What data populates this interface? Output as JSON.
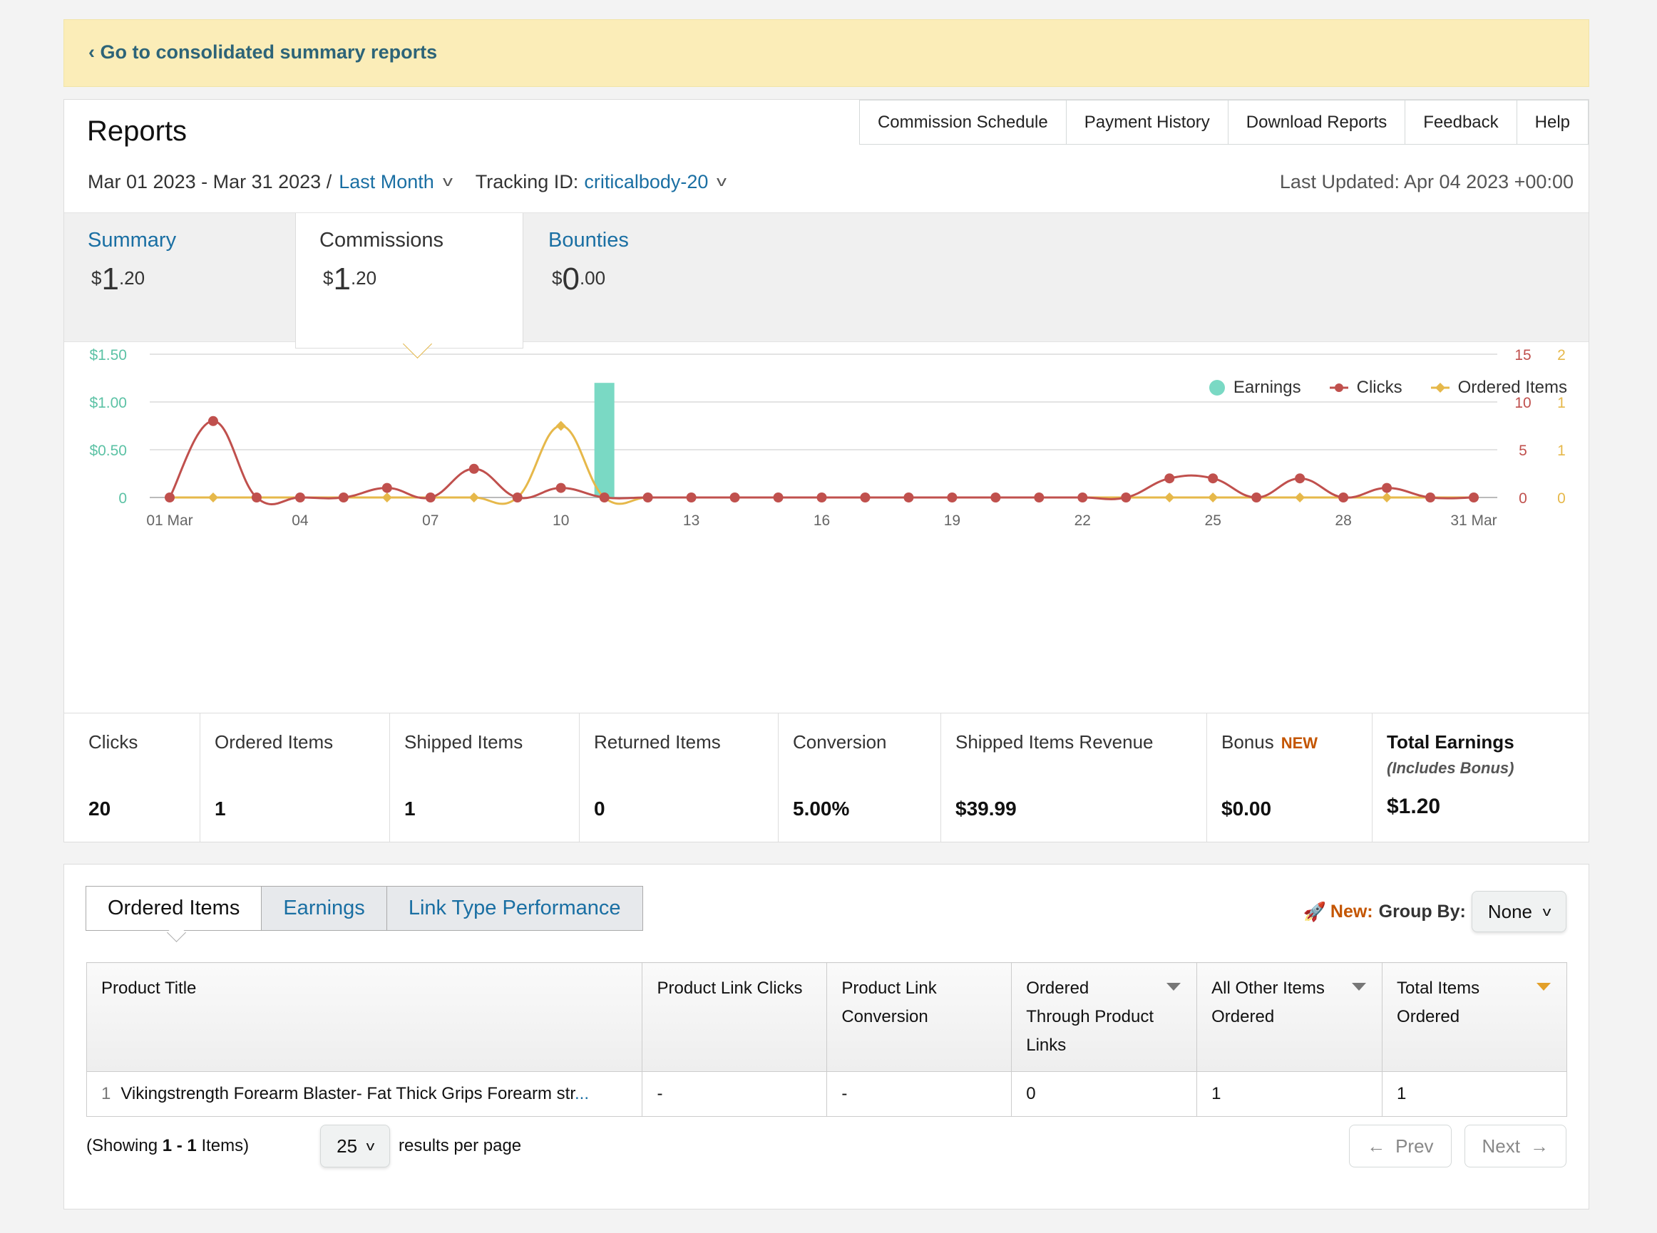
{
  "banner": {
    "link": "‹ Go to consolidated summary reports"
  },
  "header": {
    "title": "Reports",
    "nav": [
      "Commission Schedule",
      "Payment History",
      "Download Reports",
      "Feedback",
      "Help"
    ],
    "date_range": "Mar 01 2023 - Mar 31 2023 /",
    "period": "Last Month",
    "tracking_label": "Tracking ID:",
    "tracking_id": "criticalbody-20",
    "last_updated": "Last Updated: Apr 04 2023 +00:00"
  },
  "summary_tabs": [
    {
      "label": "Summary",
      "currency": "$",
      "dollars": "1",
      "cents": ".20"
    },
    {
      "label": "Commissions",
      "currency": "$",
      "dollars": "1",
      "cents": ".20"
    },
    {
      "label": "Bounties",
      "currency": "$",
      "dollars": "0",
      "cents": ".00"
    }
  ],
  "colors": {
    "earnings": "#7ad9c4",
    "clicks": "#c0504d",
    "ordered": "#e6b84a",
    "link": "#1a6fa3",
    "accent": "#c45500"
  },
  "chart_data": {
    "type": "line",
    "legend": [
      "Earnings",
      "Clicks",
      "Ordered Items"
    ],
    "x": [
      "01 Mar",
      "02",
      "03",
      "04",
      "05",
      "06",
      "07",
      "08",
      "09",
      "10",
      "11",
      "12",
      "13",
      "14",
      "15",
      "16",
      "17",
      "18",
      "19",
      "20",
      "21",
      "22",
      "23",
      "24",
      "25",
      "26",
      "27",
      "28",
      "29",
      "30",
      "31 Mar"
    ],
    "x_tick_labels": [
      "01 Mar",
      "04",
      "07",
      "10",
      "13",
      "16",
      "19",
      "22",
      "25",
      "28",
      "31 Mar"
    ],
    "series": [
      {
        "name": "Earnings",
        "kind": "bar",
        "axis": "left",
        "values": [
          0,
          0,
          0,
          0,
          0,
          0,
          0,
          0,
          0,
          0,
          1.2,
          0,
          0,
          0,
          0,
          0,
          0,
          0,
          0,
          0,
          0,
          0,
          0,
          0,
          0,
          0,
          0,
          0,
          0,
          0,
          0
        ]
      },
      {
        "name": "Clicks",
        "kind": "line",
        "axis": "right1",
        "values": [
          0,
          8,
          0,
          0,
          0,
          1,
          0,
          3,
          0,
          1,
          0,
          0,
          0,
          0,
          0,
          0,
          0,
          0,
          0,
          0,
          0,
          0,
          0,
          2,
          2,
          0,
          2,
          0,
          1,
          0,
          0
        ]
      },
      {
        "name": "Ordered Items",
        "kind": "line",
        "axis": "right2",
        "values": [
          0,
          0,
          0,
          0,
          0,
          0,
          0,
          0,
          0,
          1,
          0,
          0,
          0,
          0,
          0,
          0,
          0,
          0,
          0,
          0,
          0,
          0,
          0,
          0,
          0,
          0,
          0,
          0,
          0,
          0,
          0
        ]
      }
    ],
    "y_left": {
      "ticks": [
        "0",
        "$0.50",
        "$1.00",
        "$1.50"
      ],
      "ylim": [
        0,
        1.5
      ]
    },
    "y_right1": {
      "ticks": [
        "0",
        "5",
        "10",
        "15"
      ],
      "ylim": [
        0,
        15
      ]
    },
    "y_right2": {
      "ticks": [
        "0",
        "1",
        "1",
        "2"
      ],
      "ylim": [
        0,
        2
      ]
    },
    "legend_position": "top-right",
    "grid": true
  },
  "stats": [
    {
      "label": "Clicks",
      "value": "20"
    },
    {
      "label": "Ordered Items",
      "value": "1"
    },
    {
      "label": "Shipped Items",
      "value": "1"
    },
    {
      "label": "Returned Items",
      "value": "0"
    },
    {
      "label": "Conversion",
      "value": "5.00%"
    },
    {
      "label": "Shipped Items Revenue",
      "value": "$39.99"
    },
    {
      "label": "Bonus",
      "badge": "NEW",
      "value": "$0.00"
    },
    {
      "label": "Total Earnings",
      "sub": "(Includes Bonus)",
      "value": "$1.20"
    }
  ],
  "report_tabs": [
    "Ordered Items",
    "Earnings",
    "Link Type Performance"
  ],
  "group_by": {
    "new": "New:",
    "label": "Group By:",
    "value": "None"
  },
  "table": {
    "headers": [
      "Product Title",
      "Product Link Clicks",
      "Product Link Conversion",
      "Ordered Through Product Links",
      "All Other Items Ordered",
      "Total Items Ordered"
    ],
    "rows": [
      {
        "num": "1",
        "title": "Vikingstrength Forearm Blaster- Fat Thick Grips Forearm str",
        "ellipsis": "...",
        "clicks": "-",
        "conversion": "-",
        "ordered_through": "0",
        "other": "1",
        "total": "1"
      }
    ]
  },
  "pagination": {
    "showing_prefix": "(Showing",
    "showing_range": "1 - 1",
    "showing_suffix": "Items)",
    "per_page": "25",
    "per_page_label": "results per page",
    "prev": "Prev",
    "next": "Next"
  }
}
